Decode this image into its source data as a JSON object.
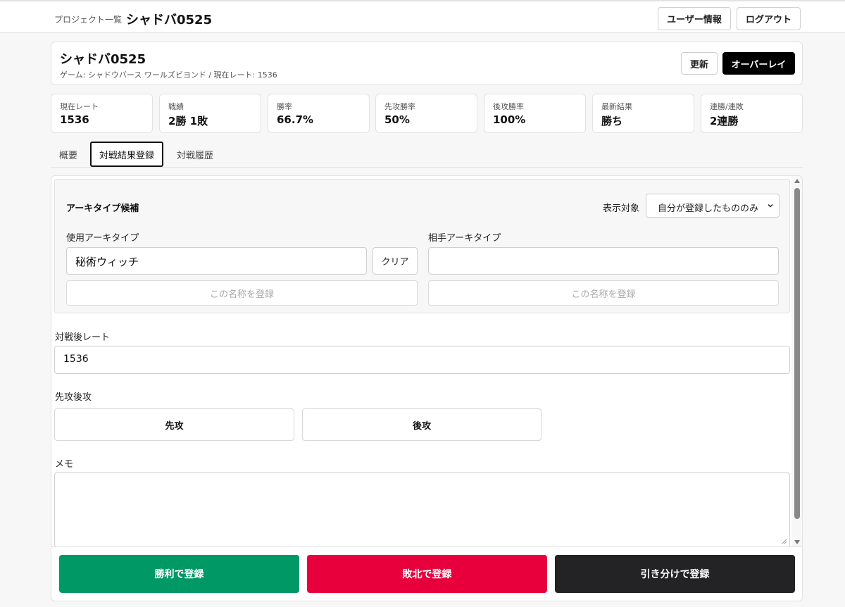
{
  "header": {
    "breadcrumb": "プロジェクト一覧",
    "title": "シャドバ0525",
    "user_info_label": "ユーザー情報",
    "logout_label": "ログアウト"
  },
  "project": {
    "name": "シャドバ0525",
    "subtitle": "ゲーム: シャドウバース ワールズビヨンド / 現在レート: 1536",
    "refresh_label": "更新",
    "overlay_label": "オーバーレイ"
  },
  "stats": [
    {
      "label": "現在レート",
      "value": "1536"
    },
    {
      "label": "戦績",
      "value": "2勝 1敗"
    },
    {
      "label": "勝率",
      "value": "66.7%"
    },
    {
      "label": "先攻勝率",
      "value": "50%"
    },
    {
      "label": "後攻勝率",
      "value": "100%"
    },
    {
      "label": "最新結果",
      "value": "勝ち"
    },
    {
      "label": "連勝/連敗",
      "value": "2連勝"
    }
  ],
  "tabs": [
    {
      "label": "概要",
      "active": false
    },
    {
      "label": "対戦結果登録",
      "active": true
    },
    {
      "label": "対戦履歴",
      "active": false
    }
  ],
  "archetype": {
    "title": "アーキタイプ候補",
    "display_label": "表示対象",
    "display_selected": "自分が登録したもののみ",
    "my_label": "使用アーキタイプ",
    "my_value": "秘術ウィッチ",
    "clear_label": "クリア",
    "opp_label": "相手アーキタイプ",
    "opp_value": "",
    "register_name_label": "この名称を登録"
  },
  "rating": {
    "label": "対戦後レート",
    "value": "1536"
  },
  "turn": {
    "label": "先攻後攻",
    "first_label": "先攻",
    "second_label": "後攻"
  },
  "memo": {
    "label": "メモ",
    "value": ""
  },
  "actions": {
    "win_label": "勝利で登録",
    "lose_label": "敗北で登録",
    "draw_label": "引き分けで登録"
  },
  "colors": {
    "win": "#009966",
    "lose": "#e8003d",
    "draw": "#232326",
    "overlay_button": "#000000"
  },
  "icons": {
    "select_chevron": "chevron-down-icon",
    "scroll_up": "scroll-up-arrow-icon",
    "scroll_down": "scroll-down-arrow-icon",
    "textarea_resize": "resize-handle-icon"
  }
}
